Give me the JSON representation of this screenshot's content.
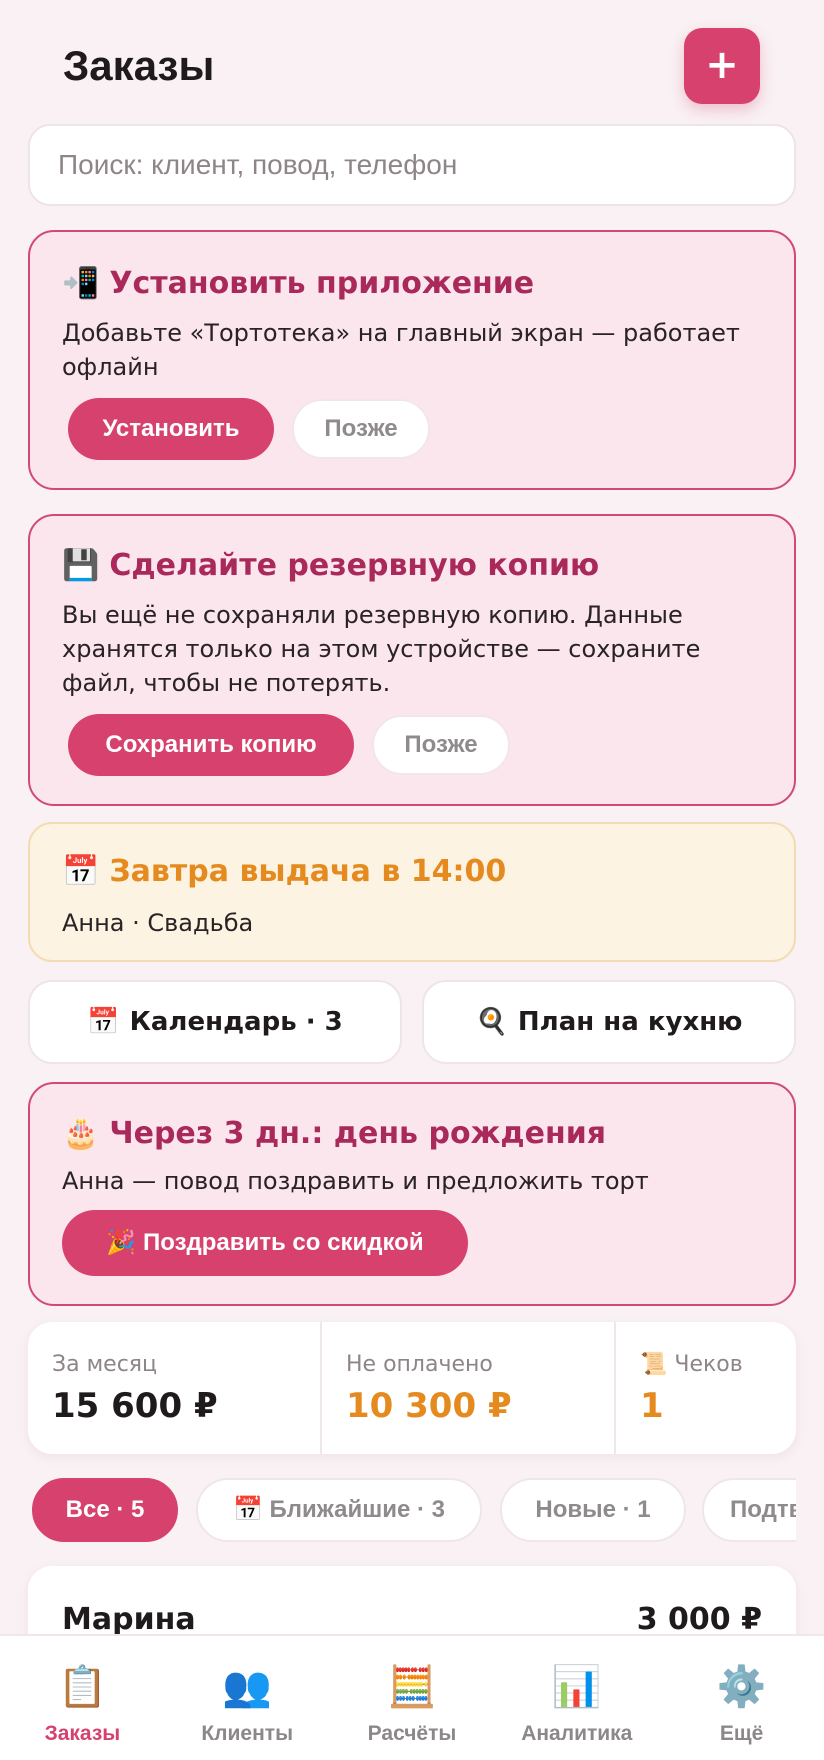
{
  "header": {
    "title": "Заказы",
    "add_label": "+"
  },
  "search": {
    "placeholder": "Поиск: клиент, повод, телефон"
  },
  "install_banner": {
    "icon": "📲",
    "title": "Установить приложение",
    "text": "Добавьте «Тортотека» на главный экран — работает офлайн",
    "primary": "Установить",
    "secondary": "Позже"
  },
  "backup_banner": {
    "icon": "💾",
    "title": "Сделайте резервную копию",
    "text": "Вы ещё не сохраняли резервную копию. Данные хранятся только на этом устройстве — сохраните файл, чтобы не потерять.",
    "primary": "Сохранить копию",
    "secondary": "Позже"
  },
  "reminder": {
    "icon": "📅",
    "title": "Завтра выдача в 14:00",
    "text": "Анна · Свадьба"
  },
  "quick_links": {
    "calendar": {
      "icon": "📅",
      "label": "Календарь · 3"
    },
    "kitchen": {
      "icon": "🍳",
      "label": "План на кухню"
    }
  },
  "birthday_banner": {
    "icon": "🎂",
    "title": "Через 3 дн.: день рождения",
    "text": "Анна — повод поздравить и предложить торт",
    "button_icon": "🎉",
    "button": "Поздравить со скидкой"
  },
  "stats": {
    "month_label": "За месяц",
    "month_value": "15 600 ₽",
    "unpaid_label": "Не оплачено",
    "unpaid_value": "10 300 ₽",
    "receipts_icon": "📜",
    "receipts_label": "Чеков",
    "receipts_value": "1"
  },
  "filters": {
    "all": "Все · 5",
    "upcoming_icon": "📅",
    "upcoming": "Ближайшие · 3",
    "new": "Новые · 1",
    "confirmed": "Подтверждены"
  },
  "order": {
    "client": "Марина",
    "price": "3 000 ₽"
  },
  "nav": [
    {
      "icon": "📋",
      "label": "Заказы"
    },
    {
      "icon": "👥",
      "label": "Клиенты"
    },
    {
      "icon": "🧮",
      "label": "Расчёты"
    },
    {
      "icon": "📊",
      "label": "Аналитика"
    },
    {
      "icon": "⚙️",
      "label": "Ещё"
    }
  ],
  "colors": {
    "accent": "#d6426d",
    "banner_bg": "#fbe6ee",
    "banner_title": "#a9295a",
    "warning": "#e58a1f",
    "reminder_bg": "#fdf3e2"
  }
}
